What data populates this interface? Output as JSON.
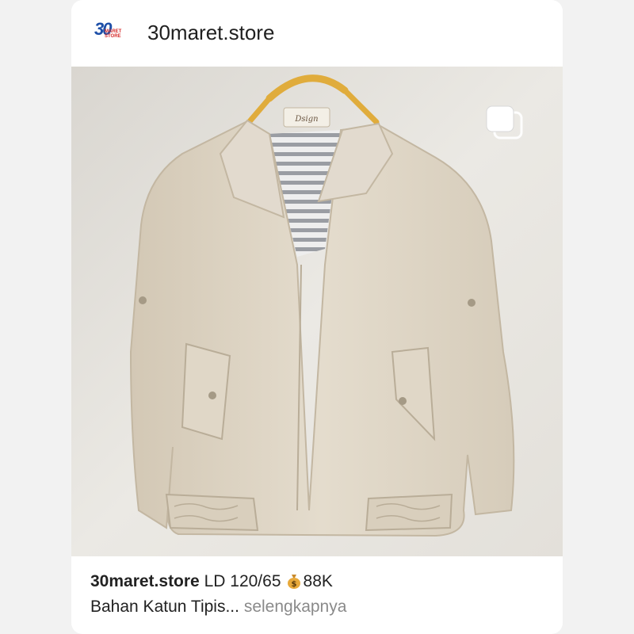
{
  "post": {
    "account": "30maret.store",
    "avatar": {
      "number": "30",
      "sub": "MARET STORE"
    },
    "caption": {
      "user": "30maret.store",
      "line1_text": "LD 120/65",
      "line1_icon": "money-bag-icon",
      "line1_price": "88K",
      "line2_text": "Bahan Katun Tipis",
      "line2_ellipsis": "...",
      "more_label": "selengkapnya"
    },
    "media": {
      "label_text": "Dsign",
      "multi_image_icon": "carousel-icon"
    }
  },
  "colors": {
    "background": "#f2f2f2",
    "card": "#ffffff",
    "jacket": "#ddd3c1",
    "wall": "#e6e4df",
    "hanger": "#e0ac3c",
    "accent": "#1d4fa8"
  }
}
